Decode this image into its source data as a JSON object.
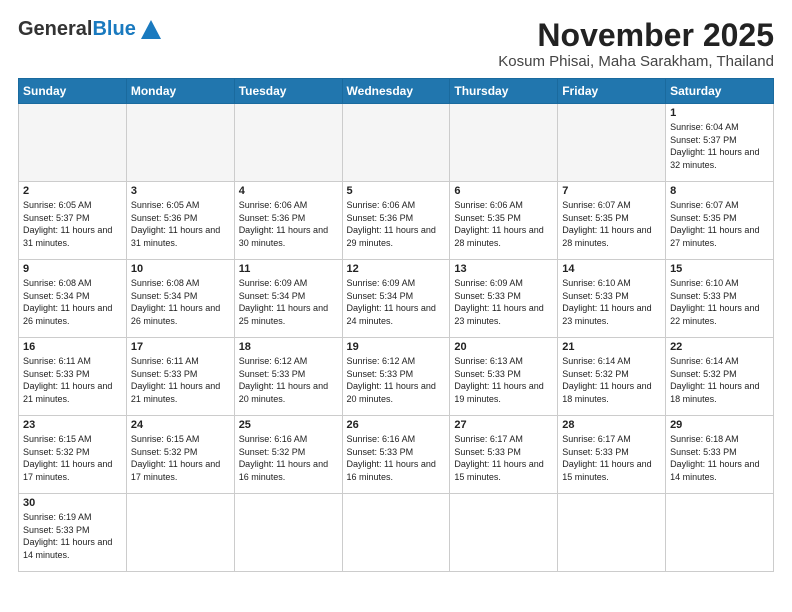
{
  "header": {
    "logo_general": "General",
    "logo_blue": "Blue",
    "month_title": "November 2025",
    "location": "Kosum Phisai, Maha Sarakham, Thailand"
  },
  "weekdays": [
    "Sunday",
    "Monday",
    "Tuesday",
    "Wednesday",
    "Thursday",
    "Friday",
    "Saturday"
  ],
  "days": [
    {
      "num": "",
      "sunrise": "",
      "sunset": "",
      "daylight": "",
      "empty": true
    },
    {
      "num": "",
      "sunrise": "",
      "sunset": "",
      "daylight": "",
      "empty": true
    },
    {
      "num": "",
      "sunrise": "",
      "sunset": "",
      "daylight": "",
      "empty": true
    },
    {
      "num": "",
      "sunrise": "",
      "sunset": "",
      "daylight": "",
      "empty": true
    },
    {
      "num": "",
      "sunrise": "",
      "sunset": "",
      "daylight": "",
      "empty": true
    },
    {
      "num": "",
      "sunrise": "",
      "sunset": "",
      "daylight": "",
      "empty": true
    },
    {
      "num": "1",
      "sunrise": "Sunrise: 6:04 AM",
      "sunset": "Sunset: 5:37 PM",
      "daylight": "Daylight: 11 hours and 32 minutes.",
      "empty": false
    },
    {
      "num": "2",
      "sunrise": "Sunrise: 6:05 AM",
      "sunset": "Sunset: 5:37 PM",
      "daylight": "Daylight: 11 hours and 31 minutes.",
      "empty": false
    },
    {
      "num": "3",
      "sunrise": "Sunrise: 6:05 AM",
      "sunset": "Sunset: 5:36 PM",
      "daylight": "Daylight: 11 hours and 31 minutes.",
      "empty": false
    },
    {
      "num": "4",
      "sunrise": "Sunrise: 6:06 AM",
      "sunset": "Sunset: 5:36 PM",
      "daylight": "Daylight: 11 hours and 30 minutes.",
      "empty": false
    },
    {
      "num": "5",
      "sunrise": "Sunrise: 6:06 AM",
      "sunset": "Sunset: 5:36 PM",
      "daylight": "Daylight: 11 hours and 29 minutes.",
      "empty": false
    },
    {
      "num": "6",
      "sunrise": "Sunrise: 6:06 AM",
      "sunset": "Sunset: 5:35 PM",
      "daylight": "Daylight: 11 hours and 28 minutes.",
      "empty": false
    },
    {
      "num": "7",
      "sunrise": "Sunrise: 6:07 AM",
      "sunset": "Sunset: 5:35 PM",
      "daylight": "Daylight: 11 hours and 28 minutes.",
      "empty": false
    },
    {
      "num": "8",
      "sunrise": "Sunrise: 6:07 AM",
      "sunset": "Sunset: 5:35 PM",
      "daylight": "Daylight: 11 hours and 27 minutes.",
      "empty": false
    },
    {
      "num": "9",
      "sunrise": "Sunrise: 6:08 AM",
      "sunset": "Sunset: 5:34 PM",
      "daylight": "Daylight: 11 hours and 26 minutes.",
      "empty": false
    },
    {
      "num": "10",
      "sunrise": "Sunrise: 6:08 AM",
      "sunset": "Sunset: 5:34 PM",
      "daylight": "Daylight: 11 hours and 26 minutes.",
      "empty": false
    },
    {
      "num": "11",
      "sunrise": "Sunrise: 6:09 AM",
      "sunset": "Sunset: 5:34 PM",
      "daylight": "Daylight: 11 hours and 25 minutes.",
      "empty": false
    },
    {
      "num": "12",
      "sunrise": "Sunrise: 6:09 AM",
      "sunset": "Sunset: 5:34 PM",
      "daylight": "Daylight: 11 hours and 24 minutes.",
      "empty": false
    },
    {
      "num": "13",
      "sunrise": "Sunrise: 6:09 AM",
      "sunset": "Sunset: 5:33 PM",
      "daylight": "Daylight: 11 hours and 23 minutes.",
      "empty": false
    },
    {
      "num": "14",
      "sunrise": "Sunrise: 6:10 AM",
      "sunset": "Sunset: 5:33 PM",
      "daylight": "Daylight: 11 hours and 23 minutes.",
      "empty": false
    },
    {
      "num": "15",
      "sunrise": "Sunrise: 6:10 AM",
      "sunset": "Sunset: 5:33 PM",
      "daylight": "Daylight: 11 hours and 22 minutes.",
      "empty": false
    },
    {
      "num": "16",
      "sunrise": "Sunrise: 6:11 AM",
      "sunset": "Sunset: 5:33 PM",
      "daylight": "Daylight: 11 hours and 21 minutes.",
      "empty": false
    },
    {
      "num": "17",
      "sunrise": "Sunrise: 6:11 AM",
      "sunset": "Sunset: 5:33 PM",
      "daylight": "Daylight: 11 hours and 21 minutes.",
      "empty": false
    },
    {
      "num": "18",
      "sunrise": "Sunrise: 6:12 AM",
      "sunset": "Sunset: 5:33 PM",
      "daylight": "Daylight: 11 hours and 20 minutes.",
      "empty": false
    },
    {
      "num": "19",
      "sunrise": "Sunrise: 6:12 AM",
      "sunset": "Sunset: 5:33 PM",
      "daylight": "Daylight: 11 hours and 20 minutes.",
      "empty": false
    },
    {
      "num": "20",
      "sunrise": "Sunrise: 6:13 AM",
      "sunset": "Sunset: 5:33 PM",
      "daylight": "Daylight: 11 hours and 19 minutes.",
      "empty": false
    },
    {
      "num": "21",
      "sunrise": "Sunrise: 6:14 AM",
      "sunset": "Sunset: 5:32 PM",
      "daylight": "Daylight: 11 hours and 18 minutes.",
      "empty": false
    },
    {
      "num": "22",
      "sunrise": "Sunrise: 6:14 AM",
      "sunset": "Sunset: 5:32 PM",
      "daylight": "Daylight: 11 hours and 18 minutes.",
      "empty": false
    },
    {
      "num": "23",
      "sunrise": "Sunrise: 6:15 AM",
      "sunset": "Sunset: 5:32 PM",
      "daylight": "Daylight: 11 hours and 17 minutes.",
      "empty": false
    },
    {
      "num": "24",
      "sunrise": "Sunrise: 6:15 AM",
      "sunset": "Sunset: 5:32 PM",
      "daylight": "Daylight: 11 hours and 17 minutes.",
      "empty": false
    },
    {
      "num": "25",
      "sunrise": "Sunrise: 6:16 AM",
      "sunset": "Sunset: 5:32 PM",
      "daylight": "Daylight: 11 hours and 16 minutes.",
      "empty": false
    },
    {
      "num": "26",
      "sunrise": "Sunrise: 6:16 AM",
      "sunset": "Sunset: 5:33 PM",
      "daylight": "Daylight: 11 hours and 16 minutes.",
      "empty": false
    },
    {
      "num": "27",
      "sunrise": "Sunrise: 6:17 AM",
      "sunset": "Sunset: 5:33 PM",
      "daylight": "Daylight: 11 hours and 15 minutes.",
      "empty": false
    },
    {
      "num": "28",
      "sunrise": "Sunrise: 6:17 AM",
      "sunset": "Sunset: 5:33 PM",
      "daylight": "Daylight: 11 hours and 15 minutes.",
      "empty": false
    },
    {
      "num": "29",
      "sunrise": "Sunrise: 6:18 AM",
      "sunset": "Sunset: 5:33 PM",
      "daylight": "Daylight: 11 hours and 14 minutes.",
      "empty": false
    },
    {
      "num": "30",
      "sunrise": "Sunrise: 6:19 AM",
      "sunset": "Sunset: 5:33 PM",
      "daylight": "Daylight: 11 hours and 14 minutes.",
      "empty": false
    }
  ]
}
